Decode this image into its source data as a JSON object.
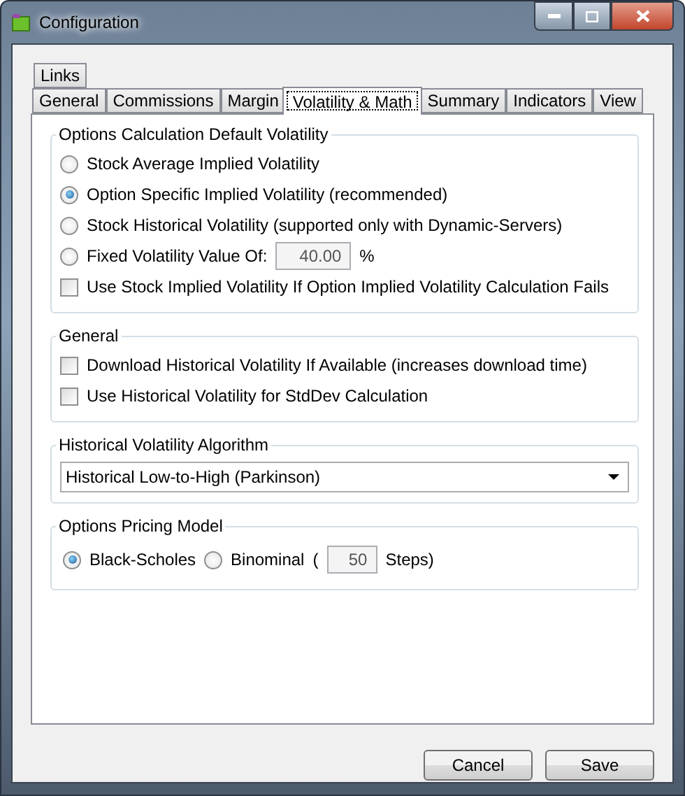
{
  "window": {
    "title": "Configuration"
  },
  "tab_rows": [
    [
      {
        "label": "Links",
        "selected": false
      }
    ],
    [
      {
        "label": "General",
        "selected": false
      },
      {
        "label": "Commissions",
        "selected": false
      },
      {
        "label": "Margin",
        "selected": false
      },
      {
        "label": "Volatility & Math",
        "selected": true
      },
      {
        "label": "Summary",
        "selected": false
      },
      {
        "label": "Indicators",
        "selected": false
      },
      {
        "label": "View",
        "selected": false
      }
    ]
  ],
  "groups": [
    {
      "title": "Options Calculation Default Volatility",
      "items": [
        {
          "kind": "radio",
          "label": "Stock Average Implied Volatility",
          "selected": false
        },
        {
          "kind": "radio",
          "label": "Option Specific Implied Volatility (recommended)",
          "selected": true
        },
        {
          "kind": "radio",
          "label": "Stock Historical Volatility (supported only with Dynamic-Servers)",
          "selected": false
        },
        {
          "kind": "radio_field",
          "label": "Fixed Volatility Value Of:",
          "selected": false,
          "value": "40.00",
          "disabled": true,
          "unit": "%"
        },
        {
          "kind": "checkbox",
          "label": "Use Stock Implied Volatility If Option Implied Volatility Calculation Fails",
          "checked": false
        }
      ]
    },
    {
      "title": "General",
      "items": [
        {
          "kind": "checkbox",
          "label": "Download Historical Volatility If Available (increases download time)",
          "checked": false
        },
        {
          "kind": "checkbox",
          "label": "Use Historical Volatility for StdDev Calculation",
          "checked": false
        }
      ]
    },
    {
      "title": "Historical Volatility Algorithm",
      "items": [
        {
          "kind": "select",
          "value": "Historical Low-to-High (Parkinson)"
        }
      ]
    },
    {
      "title": "Options Pricing Model",
      "items": [
        {
          "kind": "radio_row",
          "options": [
            {
              "label": "Black-Scholes",
              "selected": true
            },
            {
              "label": "Binominal",
              "selected": false,
              "open": "(",
              "value": "50",
              "disabled": true,
              "close": "Steps)"
            }
          ]
        }
      ]
    }
  ],
  "buttons": [
    "Cancel",
    "Save"
  ]
}
